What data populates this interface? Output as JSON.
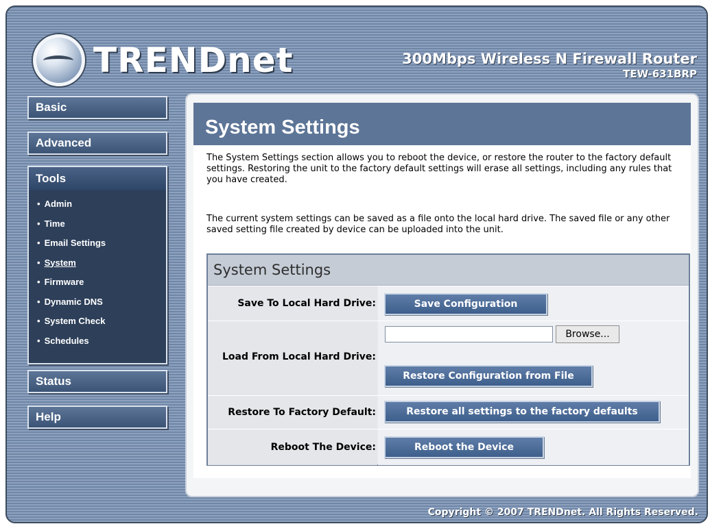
{
  "header": {
    "brand": "TRENDnet",
    "product_name": "300Mbps Wireless N Firewall Router",
    "model": "TEW-631BRP"
  },
  "sidebar": {
    "basic": "Basic",
    "advanced": "Advanced",
    "tools": "Tools",
    "tools_items": [
      "Admin",
      "Time",
      "Email Settings",
      "System",
      "Firmware",
      "Dynamic DNS",
      "System Check",
      "Schedules"
    ],
    "active_item": "System",
    "status": "Status",
    "help": "Help"
  },
  "main": {
    "title": "System Settings",
    "desc1": "The System Settings section allows you to reboot the device, or restore the router to the factory default settings. Restoring the unit to the factory default settings will erase all settings, including any rules that you have created.",
    "desc2": "The current system settings can be saved as a file onto the local hard drive. The saved file or any other saved setting file created by device can be uploaded into the unit.",
    "panel_title": "System Settings",
    "rows": {
      "save_label": "Save To Local Hard Drive:",
      "save_button": "Save Configuration",
      "load_label": "Load From Local Hard Drive:",
      "file_value": "",
      "browse_button": "Browse...",
      "restore_file_button": "Restore Configuration from File",
      "factory_label": "Restore To Factory Default:",
      "factory_button": "Restore all settings to the factory defaults",
      "reboot_label": "Reboot The Device:",
      "reboot_button": "Reboot the Device"
    }
  },
  "footer": {
    "copyright": "Copyright © 2007 TRENDnet. All Rights Reserved."
  },
  "colors": {
    "header_stripe": "#6f86a6",
    "nav_dark": "#2d3f59",
    "title_bar": "#5d7597",
    "button": "#3e5f8c"
  }
}
